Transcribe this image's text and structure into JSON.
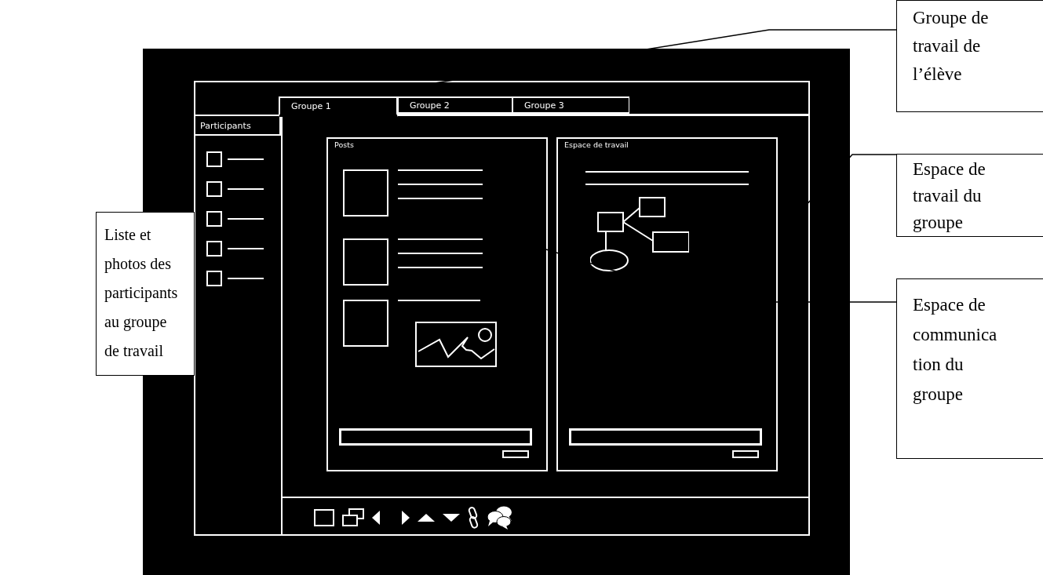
{
  "tabs": [
    {
      "label": "Groupe 1",
      "selected": true
    },
    {
      "label": "Groupe 2",
      "selected": false
    },
    {
      "label": "Groupe 3",
      "selected": false
    }
  ],
  "sidebar": {
    "title": "Participants"
  },
  "panels": [
    {
      "title": "Posts",
      "kind": "posts"
    },
    {
      "title": "Espace de travail",
      "kind": "workspace"
    }
  ],
  "annotations": [
    {
      "text": "Groupe de\ntravail de\nl’élève"
    },
    {
      "text": "Espace de\ntravail du\ngroupe"
    },
    {
      "text": "Espace de\ncommunica\ntion du\ngroupe"
    },
    {
      "text": "Liste et\nphotos des\nparticipants\nau groupe\nde travail"
    }
  ]
}
